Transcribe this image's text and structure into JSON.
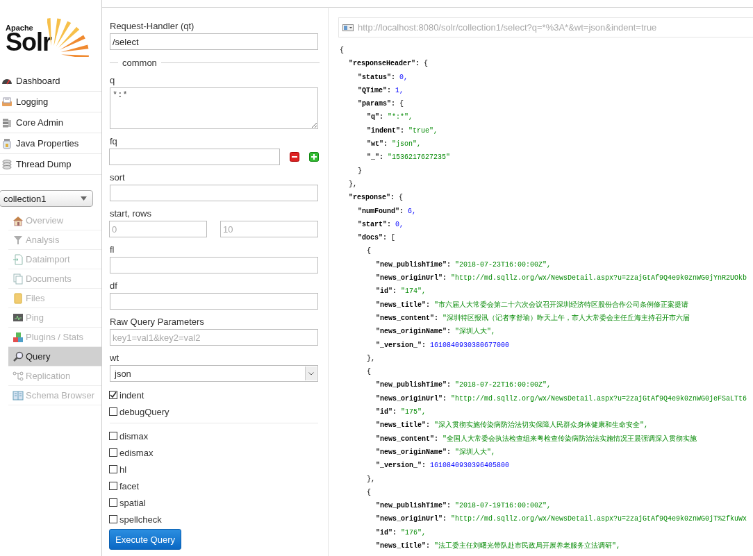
{
  "logo": {
    "small": "Apache",
    "large": "Solr"
  },
  "nav": [
    {
      "label": "Dashboard"
    },
    {
      "label": "Logging"
    },
    {
      "label": "Core Admin"
    },
    {
      "label": "Java Properties"
    },
    {
      "label": "Thread Dump"
    }
  ],
  "core_selector": {
    "value": "collection1"
  },
  "core_menu": [
    {
      "label": "Overview",
      "selected": false,
      "disabled": true
    },
    {
      "label": "Analysis",
      "selected": false,
      "disabled": true
    },
    {
      "label": "Dataimport",
      "selected": false,
      "disabled": true
    },
    {
      "label": "Documents",
      "selected": false,
      "disabled": true
    },
    {
      "label": "Files",
      "selected": false,
      "disabled": true
    },
    {
      "label": "Ping",
      "selected": false,
      "disabled": true
    },
    {
      "label": "Plugins / Stats",
      "selected": false,
      "disabled": true
    },
    {
      "label": "Query",
      "selected": true,
      "disabled": false
    },
    {
      "label": "Replication",
      "selected": false,
      "disabled": true
    },
    {
      "label": "Schema Browser",
      "selected": false,
      "disabled": true
    }
  ],
  "query_form": {
    "handler": {
      "label": "Request-Handler (qt)",
      "value": "/select"
    },
    "section_title": "common",
    "fields": [
      {
        "kind": "textarea",
        "label": "q",
        "value": "*:*"
      },
      {
        "kind": "multi",
        "label": "fq"
      },
      {
        "kind": "text",
        "label": "sort"
      },
      {
        "kind": "pair",
        "label": "start, rows",
        "placeholders": [
          "0",
          "10"
        ]
      },
      {
        "kind": "text",
        "label": "fl"
      },
      {
        "kind": "text",
        "label": "df"
      },
      {
        "kind": "text",
        "label": "Raw Query Parameters",
        "placeholder": "key1=val1&key2=val2"
      },
      {
        "kind": "select",
        "label": "wt",
        "value": "json"
      }
    ],
    "options": [
      {
        "label": "indent",
        "checked": true
      },
      {
        "label": "debugQuery",
        "checked": false
      }
    ],
    "parsers": [
      {
        "label": "dismax",
        "checked": false
      },
      {
        "label": "edismax",
        "checked": false
      },
      {
        "label": "hl",
        "checked": false
      },
      {
        "label": "facet",
        "checked": false
      },
      {
        "label": "spatial",
        "checked": false
      },
      {
        "label": "spellcheck",
        "checked": false
      }
    ],
    "execute_button": "Execute Query"
  },
  "response": {
    "url": "http://localhost:8080/solr/collection1/select?q=*%3A*&wt=json&indent=true",
    "tree": {
      "open": "{",
      "children": [
        {
          "key": "\"responseHeader\":",
          "open": "{",
          "close": "},",
          "children": [
            {
              "key": "\"status\":",
              "value": "0,",
              "kind": "number"
            },
            {
              "key": "\"QTime\":",
              "value": "1,",
              "kind": "number"
            },
            {
              "key": "\"params\":",
              "open": "{",
              "close": "}",
              "children": [
                {
                  "key": "\"q\":",
                  "value": "\"*:*\",",
                  "kind": "string"
                },
                {
                  "key": "\"indent\":",
                  "value": "\"true\",",
                  "kind": "string"
                },
                {
                  "key": "\"wt\":",
                  "value": "\"json\",",
                  "kind": "string"
                },
                {
                  "key": "\"_\":",
                  "value": "\"1536217627235\"",
                  "kind": "string"
                }
              ]
            }
          ]
        },
        {
          "key": "\"response\":",
          "open": "{",
          "children": [
            {
              "key": "\"numFound\":",
              "value": "6,",
              "kind": "number"
            },
            {
              "key": "\"start\":",
              "value": "0,",
              "kind": "number"
            },
            {
              "key": "\"docs\":",
              "open": "[",
              "children": [
                {
                  "open": "{",
                  "close": "},",
                  "children": [
                    {
                      "key": "\"new_publishTime\":",
                      "value": "\"2018-07-23T16:00:00Z\",",
                      "kind": "string"
                    },
                    {
                      "key": "\"news_originUrl\":",
                      "value": "\"http://md.sqllz.org/wx/NewsDetail.aspx?u=2zajGtAf9Q4e9k0znWG0jYnR2UOkb",
                      "kind": "string"
                    },
                    {
                      "key": "\"id\":",
                      "value": "\"174\",",
                      "kind": "string"
                    },
                    {
                      "key": "\"news_title\":",
                      "value": "\"市六届人大常委会第二十六次会议召开深圳经济特区股份合作公司条例修正案提请",
                      "kind": "string"
                    },
                    {
                      "key": "\"news_content\":",
                      "value": "\"深圳特区报讯（记者李舒瑜）昨天上午，市人大常委会主任丘海主持召开市六届",
                      "kind": "string"
                    },
                    {
                      "key": "\"news_originName\":",
                      "value": "\"深圳人大\",",
                      "kind": "string"
                    },
                    {
                      "key": "\"_version_\":",
                      "value": "1610840930380677000",
                      "kind": "number"
                    }
                  ]
                },
                {
                  "open": "{",
                  "close": "},",
                  "children": [
                    {
                      "key": "\"new_publishTime\":",
                      "value": "\"2018-07-22T16:00:00Z\",",
                      "kind": "string"
                    },
                    {
                      "key": "\"news_originUrl\":",
                      "value": "\"http://md.sqllz.org/wx/NewsDetail.aspx?u=2zajGtAf9Q4e9k0znWG0jeFSaLTt6",
                      "kind": "string"
                    },
                    {
                      "key": "\"id\":",
                      "value": "\"175\",",
                      "kind": "string"
                    },
                    {
                      "key": "\"news_title\":",
                      "value": "\"深入贯彻实施传染病防治法切实保障人民群众身体健康和生命安全\",",
                      "kind": "string"
                    },
                    {
                      "key": "\"news_content\":",
                      "value": "\"全国人大常委会执法检查组来粤检查传染病防治法实施情况王晨强调深入贯彻实施",
                      "kind": "string"
                    },
                    {
                      "key": "\"news_originName\":",
                      "value": "\"深圳人大\",",
                      "kind": "string"
                    },
                    {
                      "key": "\"_version_\":",
                      "value": "1610840930396405800",
                      "kind": "number"
                    }
                  ]
                },
                {
                  "open": "{",
                  "children": [
                    {
                      "key": "\"new_publishTime\":",
                      "value": "\"2018-07-19T16:00:00Z\",",
                      "kind": "string"
                    },
                    {
                      "key": "\"news_originUrl\":",
                      "value": "\"http://md.sqllz.org/wx/NewsDetail.aspx?u=2zajGtAf9Q4e9k0znWG0jT%2fkuWx",
                      "kind": "string"
                    },
                    {
                      "key": "\"id\":",
                      "value": "\"176\",",
                      "kind": "string"
                    },
                    {
                      "key": "\"news_title\":",
                      "value": "\"法工委主任刘曙光带队赴市民政局开展养老服务立法调研\",",
                      "kind": "string"
                    }
                  ]
                }
              ]
            }
          ]
        }
      ]
    }
  }
}
